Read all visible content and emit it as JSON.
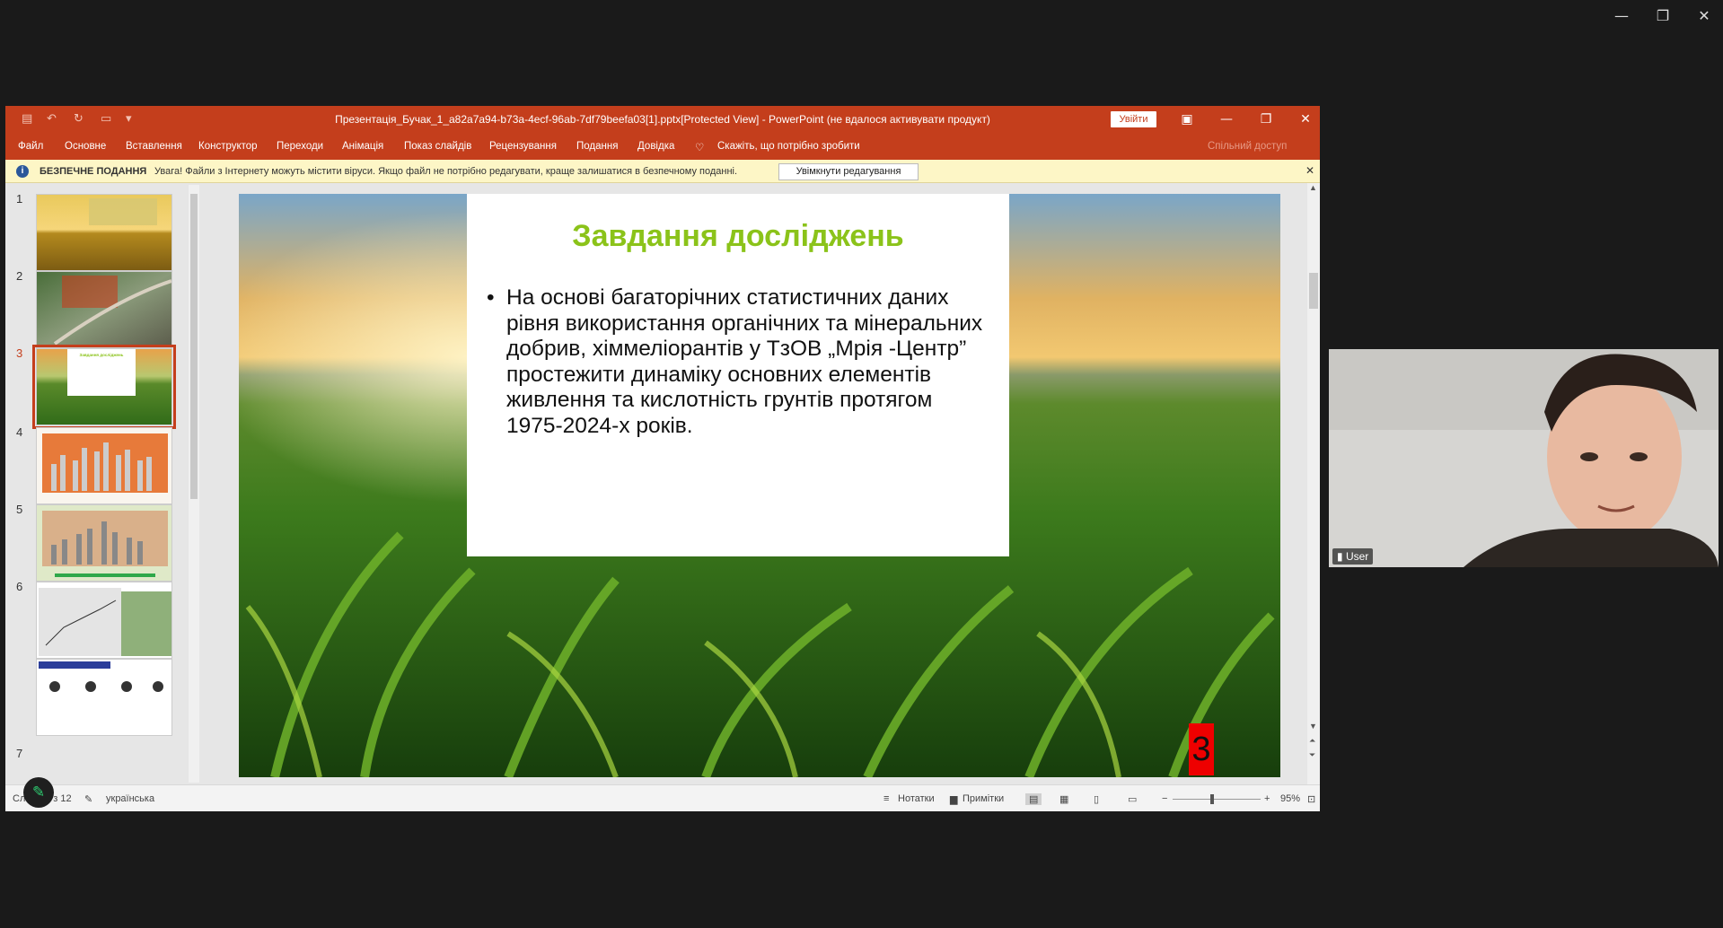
{
  "outer_window": {
    "minimize": "—",
    "restore": "❐",
    "close": "✕"
  },
  "ppt": {
    "title": "Презентація_Бучак_1_a82a7a94-b73a-4ecf-96ab-7df79beefa03[1].pptx[Protected View]  -  PowerPoint (не вдалося активувати продукт)",
    "signin": "Увійти",
    "menu": [
      "Файл",
      "Основне",
      "Вставлення",
      "Конструктор",
      "Переходи",
      "Анімація",
      "Показ слайдів",
      "Рецензування",
      "Подання",
      "Довідка"
    ],
    "tell_me": "Скажіть, що потрібно зробити",
    "share": "Спільний доступ",
    "infobar": {
      "label": "БЕЗПЕЧНЕ ПОДАННЯ",
      "message": "Увага! Файли з Інтернету можуть містити віруси. Якщо файл не потрібно редагувати, краще залишатися в безпечному поданні.",
      "button": "Увімкнути редагування"
    },
    "thumbnails": [
      {
        "num": "1"
      },
      {
        "num": "2"
      },
      {
        "num": "3"
      },
      {
        "num": "4"
      },
      {
        "num": "5"
      },
      {
        "num": "6"
      },
      {
        "num": "7"
      }
    ],
    "thumb3_title": "Завдання досліджень",
    "slide": {
      "title": "Завдання досліджень",
      "bullet": "На основі багаторічних статистичних даних рівня використання органічних та мінеральних добрив, хіммеліорантів у ТзОВ „Мрія -Центр” простежити динаміку основних елементів живлення та кислотність грунтів протягом 1975-2024-х років.",
      "number": "3"
    },
    "status": {
      "slide_info": "Слайд 3 з 12",
      "language": "українська",
      "notes": "Нотатки",
      "comments": "Примітки",
      "zoom": "95%"
    }
  },
  "video": {
    "label": "User"
  },
  "colors": {
    "accent": "#c43e1c",
    "title_green": "#8bc31a",
    "slide_num_bg": "#ee0000"
  }
}
